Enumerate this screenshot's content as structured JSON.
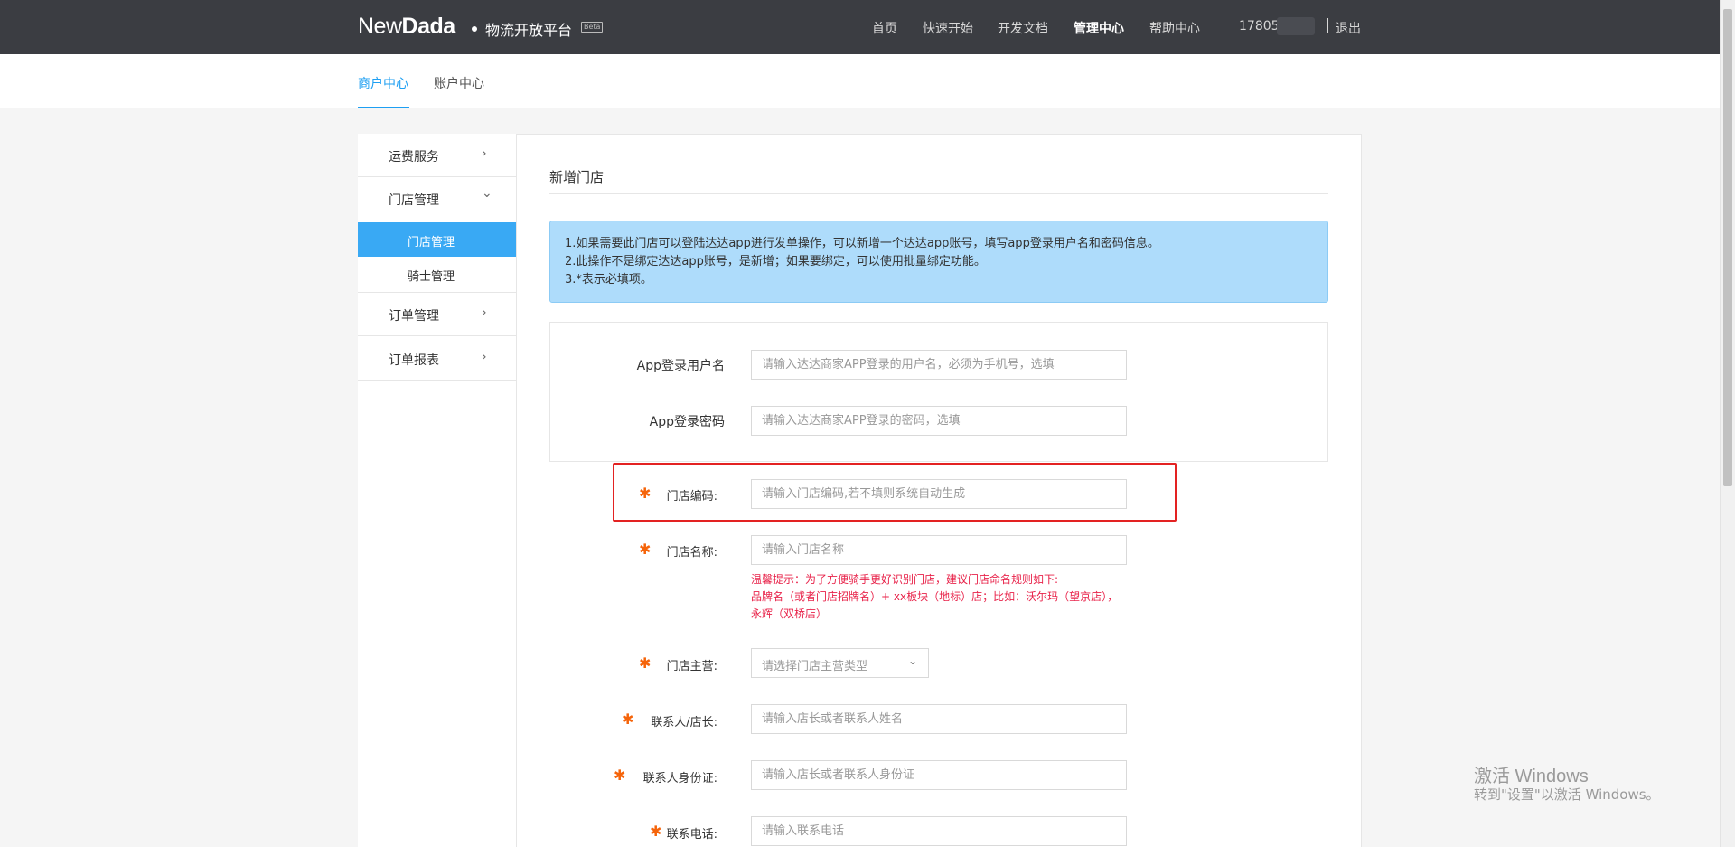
{
  "header": {
    "logo_light": "New",
    "logo_bold": "Dada",
    "platform": "物流开放平台",
    "beta": "Beta",
    "nav": [
      "首页",
      "快速开始",
      "开发文档",
      "管理中心",
      "帮助中心"
    ],
    "active_nav": "管理中心",
    "user": "17805",
    "logout": "退出"
  },
  "subnav": {
    "tabs": [
      "商户中心",
      "账户中心"
    ],
    "active": "商户中心"
  },
  "sidebar": {
    "groups": [
      {
        "label": "运费服务",
        "chevron": "›"
      },
      {
        "label": "门店管理",
        "chevron": "⌄"
      },
      {
        "label": "订单管理",
        "chevron": "›"
      },
      {
        "label": "订单报表",
        "chevron": "›"
      }
    ],
    "sub_items": [
      "门店管理",
      "骑士管理"
    ],
    "active_sub": "门店管理"
  },
  "page": {
    "title": "新增门店",
    "notice": [
      "1.如果需要此门店可以登陆达达app进行发单操作，可以新增一个达达app账号，填写app登录用户名和密码信息。",
      "2.此操作不是绑定达达app账号，是新增；如果要绑定，可以使用批量绑定功能。",
      "3.*表示必填项。"
    ]
  },
  "form": {
    "app_user": {
      "label": "App登录用户名",
      "placeholder": "请输入达达商家APP登录的用户名，必须为手机号，选填"
    },
    "app_pass": {
      "label": "App登录密码",
      "placeholder": "请输入达达商家APP登录的密码，选填"
    },
    "store_code": {
      "label": "门店编码:",
      "placeholder": "请输入门店编码,若不填则系统自动生成"
    },
    "store_name": {
      "label": "门店名称:",
      "placeholder": "请输入门店名称"
    },
    "name_hint": "温馨提示：为了方便骑手更好识别门店，建议门店命名规则如下:\n品牌名（或者门店招牌名）+ xx板块（地标）店；比如：沃尔玛（望京店），永辉（双桥店）",
    "store_type": {
      "label": "门店主营:",
      "placeholder": "请选择门店主营类型"
    },
    "contact": {
      "label": "联系人/店长:",
      "placeholder": "请输入店长或者联系人姓名"
    },
    "id_card": {
      "label": "联系人身份证:",
      "placeholder": "请输入店长或者联系人身份证"
    },
    "phone": {
      "label": "联系电话:",
      "placeholder": "请输入联系电话"
    },
    "required_mark": "✱"
  },
  "watermark": {
    "line1": "激活 Windows",
    "line2": "转到\"设置\"以激活 Windows。"
  },
  "colors": {
    "topbar": "#3b3d42",
    "accent": "#1e9ff2",
    "notice_bg": "#aedcfb",
    "required": "#f5640a",
    "hint": "#e8234a",
    "highlight_box": "#e32222"
  }
}
